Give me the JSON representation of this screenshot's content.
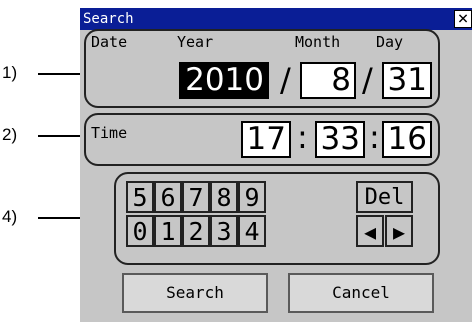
{
  "callouts": [
    "1)",
    "2)",
    "4)"
  ],
  "window": {
    "title": "Search",
    "close_label": "×"
  },
  "date": {
    "label": "Date",
    "year_label": "Year",
    "month_label": "Month",
    "day_label": "Day",
    "year": "2010",
    "month": "8",
    "day": "31",
    "separator": "/"
  },
  "time": {
    "label": "Time",
    "hour": "17",
    "minute": "33",
    "second": "16",
    "separator": ":"
  },
  "keypad": {
    "row1": [
      "5",
      "6",
      "7",
      "8",
      "9"
    ],
    "row2": [
      "0",
      "1",
      "2",
      "3",
      "4"
    ],
    "del_label": "Del",
    "left_label": "◀",
    "right_label": "▶"
  },
  "buttons": {
    "search_label": "Search",
    "cancel_label": "Cancel"
  },
  "colors": {
    "titlebar": "#0a1e96",
    "window_bg": "#c6c6c6",
    "selected_field": "#000000"
  }
}
